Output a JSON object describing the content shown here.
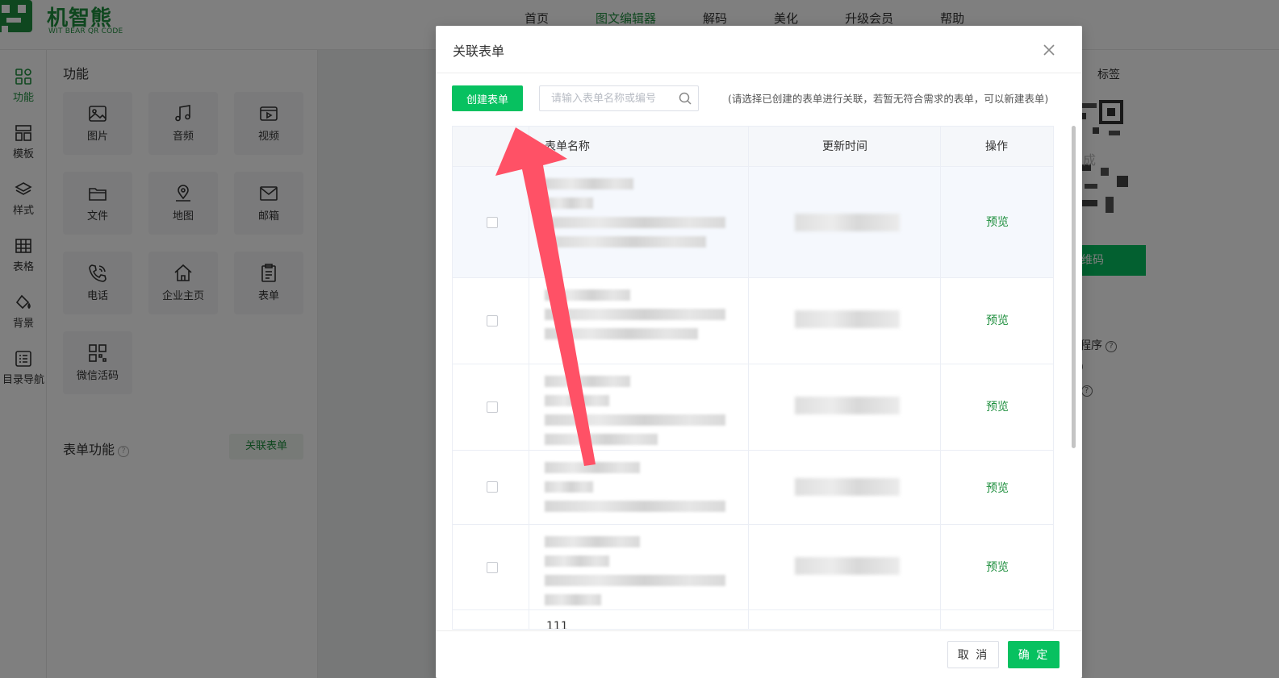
{
  "app": {
    "logo_name": "机智熊",
    "logo_sub": "WIT BEAR QR CODE",
    "brand_color": "#1f8f3e",
    "accent_color": "#07c160"
  },
  "topnav": {
    "items": [
      "首页",
      "图文编辑器",
      "解码",
      "美化",
      "升级会员",
      "帮助"
    ],
    "active_index": 1
  },
  "leftnav": {
    "items": [
      {
        "label": "功能",
        "icon": "grid-icon"
      },
      {
        "label": "模板",
        "icon": "template-icon"
      },
      {
        "label": "样式",
        "icon": "layers-icon"
      },
      {
        "label": "表格",
        "icon": "table-icon"
      },
      {
        "label": "背景",
        "icon": "paint-bucket-icon"
      },
      {
        "label": "目录导航",
        "icon": "list-icon"
      }
    ],
    "active_index": 0
  },
  "panel": {
    "title": "功能",
    "tiles": [
      {
        "label": "图片",
        "icon": "image-icon"
      },
      {
        "label": "音频",
        "icon": "music-icon"
      },
      {
        "label": "视频",
        "icon": "video-icon"
      },
      {
        "label": "文件",
        "icon": "folder-icon"
      },
      {
        "label": "地图",
        "icon": "map-pin-icon"
      },
      {
        "label": "邮箱",
        "icon": "mail-icon"
      },
      {
        "label": "电话",
        "icon": "phone-icon"
      },
      {
        "label": "企业主页",
        "icon": "home-icon"
      },
      {
        "label": "表单",
        "icon": "clipboard-icon"
      },
      {
        "label": "微信活码",
        "icon": "qrcode-icon"
      }
    ],
    "form_func_title": "表单功能",
    "link_form_button": "关联表单"
  },
  "rightpanel": {
    "tag_label": "标签",
    "qr_overlay": "生成",
    "generate_button": "二维码",
    "line1": "小程序",
    "line3_icon": "crown-icon"
  },
  "dialog": {
    "title": "关联表单",
    "create_button": "创建表单",
    "search_placeholder": "请输入表单名称或编号",
    "hint": "(请选择已创建的表单进行关联，若暂无符合需求的表单，可以新建表单)",
    "columns": [
      "表单名称",
      "更新时间",
      "操作"
    ],
    "rows": [
      {
        "action": "预览"
      },
      {
        "action": "预览"
      },
      {
        "action": "预览"
      },
      {
        "action": "预览"
      },
      {
        "action": "预览"
      }
    ],
    "partial_row_text": "111",
    "cancel_button": "取 消",
    "confirm_button": "确 定"
  },
  "annotation": {
    "arrow_color": "#ff5166"
  }
}
